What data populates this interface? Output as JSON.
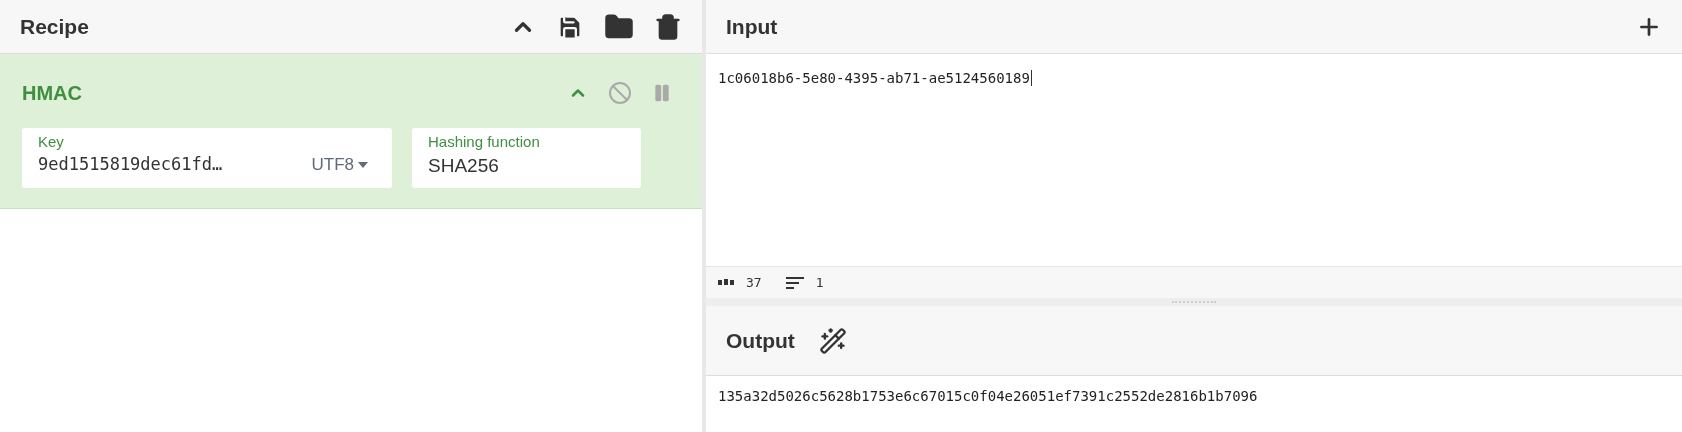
{
  "recipe": {
    "title": "Recipe",
    "operations": [
      {
        "name": "HMAC",
        "args": [
          {
            "kind": "string",
            "label": "Key",
            "value": "9ed1515819dec61fd…",
            "option": "UTF8"
          },
          {
            "kind": "select",
            "label": "Hashing function",
            "value": "SHA256"
          }
        ]
      }
    ]
  },
  "input": {
    "title": "Input",
    "value": "1c06018b6-5e80-4395-ab71-ae5124560189",
    "status": {
      "length": "37",
      "lines": "1"
    }
  },
  "output": {
    "title": "Output",
    "value": "135a32d5026c5628b1753e6c67015c0f04e26051ef7391c2552de2816b1b7096"
  }
}
